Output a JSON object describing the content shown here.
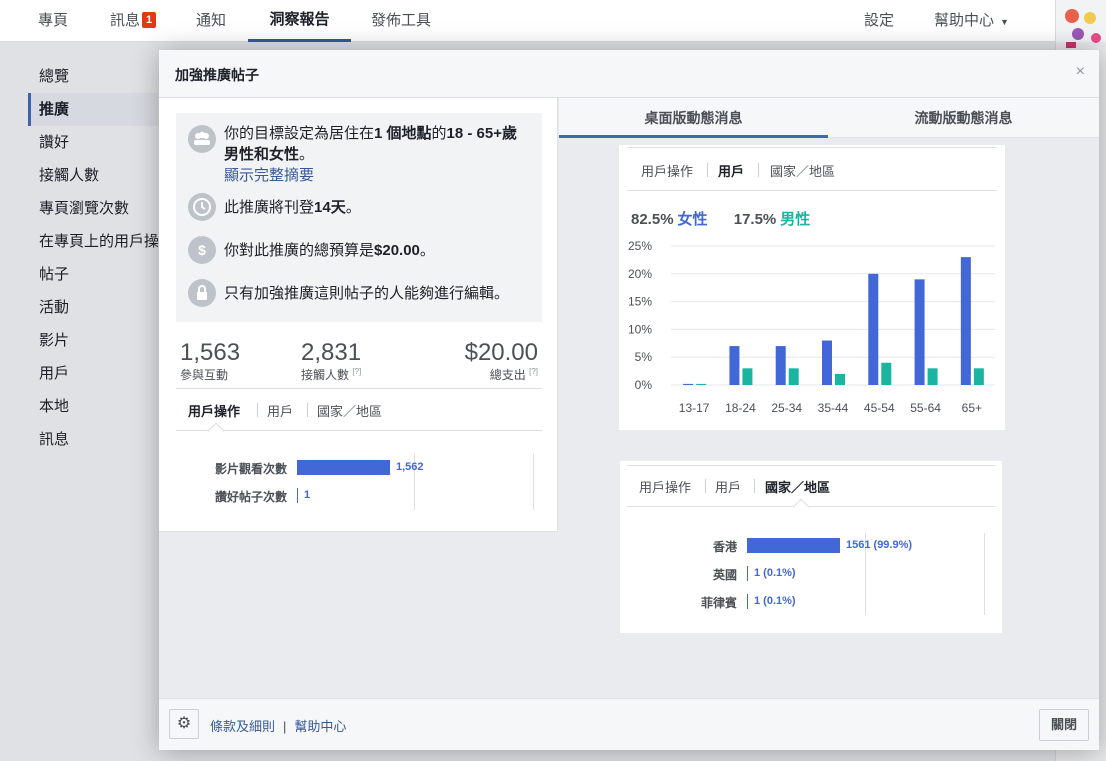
{
  "topnav": {
    "tabs": [
      {
        "label": "專頁"
      },
      {
        "label": "訊息",
        "badge": "1"
      },
      {
        "label": "通知"
      },
      {
        "label": "洞察報告",
        "active": true
      },
      {
        "label": "發佈工具"
      }
    ],
    "settings": "設定",
    "help": "幫助中心"
  },
  "sidebar": {
    "items": [
      "總覽",
      "推廣",
      "讚好",
      "接觸人數",
      "專頁瀏覽次數",
      "在專頁上的用戶操",
      "帖子",
      "活動",
      "影片",
      "用戶",
      "本地",
      "訊息"
    ],
    "active_index": 1
  },
  "modal": {
    "title": "加強推廣帖子",
    "close": "×",
    "summary": {
      "target_a": "你的目標設定為居住在",
      "target_b": "1 個地點",
      "target_c": "的",
      "target_d": "18 - 65+歲",
      "target_e": "男性和女性",
      "target_f": "。",
      "show_summary": "顯示完整摘要",
      "duration_a": "此推廣將刊登",
      "duration_b": "14天",
      "duration_c": "。",
      "budget_a": "你對此推廣的總預算是",
      "budget_b": "$20.00",
      "budget_c": "。",
      "edit_note": "只有加強推廣這則帖子的人能夠進行編輯。"
    },
    "stats": [
      {
        "value": "1,563",
        "label": "參與互動",
        "hint": ""
      },
      {
        "value": "2,831",
        "label": "接觸人數",
        "hint": "[?]"
      },
      {
        "value": "$20.00",
        "label": "總支出",
        "hint": "[?]"
      }
    ],
    "left_tabs": [
      "用戶操作",
      "用戶",
      "國家／地區"
    ],
    "actions": [
      {
        "label": "影片觀看次數",
        "value": 1562,
        "display": "1,562"
      },
      {
        "label": "讚好帖子次數",
        "value": 1,
        "display": "1"
      }
    ],
    "right_tabs": [
      "桌面版動態消息",
      "流動版動態消息"
    ],
    "people_tabs": [
      "用戶操作",
      "用戶",
      "國家／地區"
    ],
    "gender": {
      "female_pct": "82.5%",
      "female_label": "女性",
      "male_pct": "17.5%",
      "male_label": "男性"
    },
    "country_tabs": [
      "用戶操作",
      "用戶",
      "國家／地區"
    ],
    "countries": [
      {
        "label": "香港",
        "value": 1561,
        "display": "1561 (99.9%)"
      },
      {
        "label": "英國",
        "value": 1,
        "display": "1 (0.1%)"
      },
      {
        "label": "菲律賓",
        "value": 1,
        "display": "1 (0.1%)"
      }
    ],
    "footer": {
      "terms": "條款及細則",
      "help": "幫助中心",
      "close": "關閉"
    }
  },
  "colors": {
    "female": "#4267d6",
    "male": "#1ab5a0",
    "accent": "#4267b2"
  },
  "chart_data": {
    "type": "bar",
    "categories": [
      "13-17",
      "18-24",
      "25-34",
      "35-44",
      "45-54",
      "55-64",
      "65+"
    ],
    "series": [
      {
        "name": "女性",
        "values": [
          0.2,
          7,
          7,
          8,
          20,
          19,
          23
        ]
      },
      {
        "name": "男性",
        "values": [
          0.2,
          3,
          3,
          2,
          4,
          3,
          3
        ]
      }
    ],
    "yticks": [
      "0%",
      "5%",
      "10%",
      "15%",
      "20%",
      "25%"
    ],
    "ylim": [
      0,
      25
    ]
  }
}
